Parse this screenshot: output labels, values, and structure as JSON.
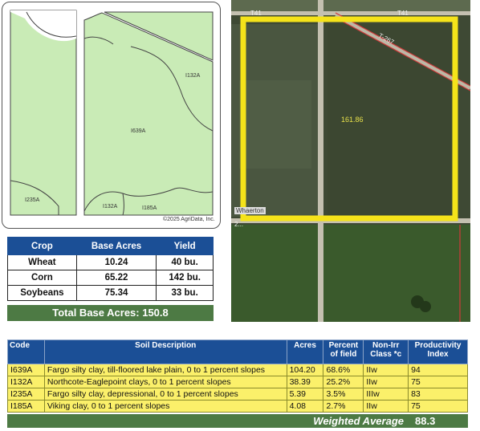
{
  "soil_map": {
    "labels": [
      "I132A",
      "I639A",
      "I235A",
      "I132A",
      "I185A"
    ],
    "copyright": "©2025 AgriData, Inc."
  },
  "aerial": {
    "road_labels": [
      "T41",
      "T41",
      "T-267",
      "Whaerton",
      "2..."
    ],
    "acres_label": "161.86",
    "accent_color": "#f5e31a"
  },
  "crop_table": {
    "headers": [
      "Crop",
      "Base Acres",
      "Yield"
    ],
    "rows": [
      {
        "crop": "Wheat",
        "acres": "10.24",
        "yield": "40 bu."
      },
      {
        "crop": "Corn",
        "acres": "65.22",
        "yield": "142 bu."
      },
      {
        "crop": "Soybeans",
        "acres": "75.34",
        "yield": "33 bu."
      }
    ],
    "total": "Total Base Acres:  150.8"
  },
  "soil_table": {
    "headers": {
      "code": "Code",
      "desc": "Soil Description",
      "acres": "Acres",
      "percent_l1": "Percent",
      "percent_l2": "of field",
      "nonirr_l1": "Non-Irr",
      "nonirr_l2": "Class *c",
      "prod_l1": "Productivity",
      "prod_l2": "Index"
    },
    "rows": [
      {
        "code": "I639A",
        "desc": "Fargo silty clay, till-floored lake plain, 0 to 1 percent slopes",
        "acres": "104.20",
        "percent": "68.6%",
        "class": "IIw",
        "index": "94"
      },
      {
        "code": "I132A",
        "desc": "Northcote-Eaglepoint clays, 0 to 1 percent slopes",
        "acres": "38.39",
        "percent": "25.2%",
        "class": "IIw",
        "index": "75"
      },
      {
        "code": "I235A",
        "desc": "Fargo silty clay, depressional, 0 to 1 percent slopes",
        "acres": "5.39",
        "percent": "3.5%",
        "class": "IIIw",
        "index": "83"
      },
      {
        "code": "I185A",
        "desc": "Viking clay, 0 to 1 percent slopes",
        "acres": "4.08",
        "percent": "2.7%",
        "class": "IIw",
        "index": "75"
      }
    ],
    "weighted_label": "Weighted Average",
    "weighted_value": "88.3"
  },
  "colors": {
    "header_blue": "#1b4f96",
    "total_green": "#4d7a44",
    "row_yellow": "#fbf06a",
    "map_green": "#c9ebb6"
  }
}
